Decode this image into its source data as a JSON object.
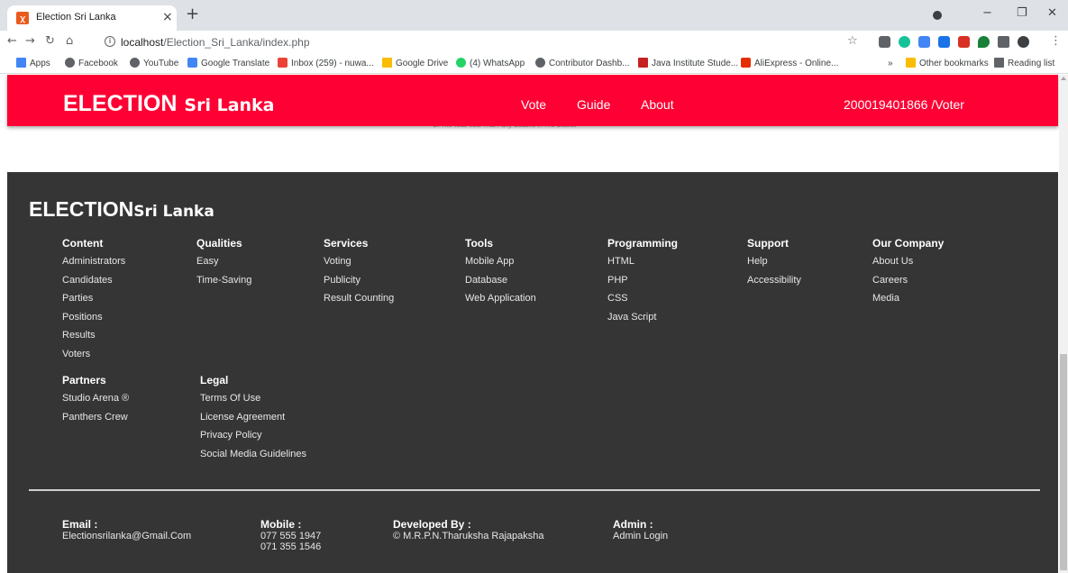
{
  "browser": {
    "tab_title": "Election Sri Lanka",
    "tab_favicon": "xampp-icon",
    "url_host": "localhost",
    "url_path": "/Election_Sri_Lanka/index.php",
    "bookmarks": [
      {
        "label": "Apps",
        "color": "#4285f4"
      },
      {
        "label": "Facebook",
        "color": "#5f6368"
      },
      {
        "label": "YouTube",
        "color": "#5f6368"
      },
      {
        "label": "Google Translate",
        "color": "#4285f4"
      },
      {
        "label": "Inbox (259) - nuwa...",
        "color": "#ea4335"
      },
      {
        "label": "Google Drive",
        "color": "#fbbc04"
      },
      {
        "label": "(4) WhatsApp",
        "color": "#25d366"
      },
      {
        "label": "Contributor Dashb...",
        "color": "#5f6368"
      },
      {
        "label": "Java Institute Stude...",
        "color": "#c5221f"
      },
      {
        "label": "AliExpress - Online...",
        "color": "#e62e04"
      }
    ],
    "other_bookmarks": "Other bookmarks",
    "reading_list": "Reading list",
    "overflow": "»"
  },
  "navbar": {
    "brand_main": "ELECTION",
    "brand_sub": "Sri Lanka",
    "links": [
      "Vote",
      "Guide",
      "About"
    ],
    "user": "200019401866 /Voter",
    "color": "#fe0033"
  },
  "partial_text": "Of The Total Vote That Party Obtains In The District",
  "footer": {
    "brand_main": "ELECTION",
    "brand_sub": "Sri Lanka",
    "columns": [
      {
        "title": "Content",
        "items": [
          "Administrators",
          "Candidates",
          "Parties",
          "Positions",
          "Results",
          "Voters"
        ]
      },
      {
        "title": "Qualities",
        "items": [
          "Easy",
          "Time-Saving"
        ]
      },
      {
        "title": "Services",
        "items": [
          "Voting",
          "Publicity",
          "Result Counting"
        ]
      },
      {
        "title": "Tools",
        "items": [
          "Mobile App",
          "Database",
          "Web Application"
        ]
      },
      {
        "title": "Programming",
        "items": [
          "HTML",
          "PHP",
          "CSS",
          "Java Script"
        ]
      },
      {
        "title": "Support",
        "items": [
          "Help",
          "Accessibility"
        ]
      },
      {
        "title": "Our Company",
        "items": [
          "About Us",
          "Careers",
          "Media"
        ]
      }
    ],
    "columns2": [
      {
        "title": "Partners",
        "items": [
          "Studio Arena ®",
          "Panthers Crew"
        ]
      },
      {
        "title": "Legal",
        "items": [
          "Terms Of Use",
          "License Agreement",
          "Privacy Policy",
          "Social Media Guidelines"
        ]
      }
    ],
    "info": [
      {
        "label": "Email :",
        "values": [
          "Electionsrilanka@Gmail.Com"
        ]
      },
      {
        "label": "Mobile :",
        "values": [
          "077 555 1947",
          "071 355 1546"
        ]
      },
      {
        "label": "Developed By :",
        "values": [
          "© M.R.P.N.Tharuksha Rajapaksha"
        ]
      },
      {
        "label": "Admin :",
        "values": [
          "Admin Login"
        ]
      }
    ],
    "background": "#353535"
  }
}
